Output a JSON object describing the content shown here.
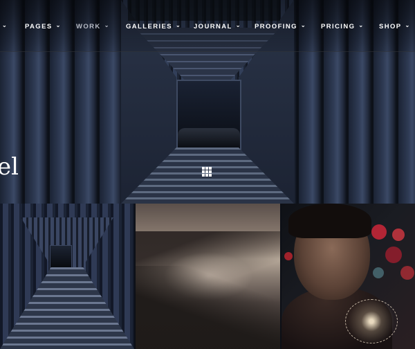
{
  "nav": {
    "items": [
      {
        "label": "",
        "active": false
      },
      {
        "label": "PAGES",
        "active": false
      },
      {
        "label": "WORK",
        "active": true
      },
      {
        "label": "GALLERIES",
        "active": false
      },
      {
        "label": "JOURNAL",
        "active": false
      },
      {
        "label": "PROOFING",
        "active": false
      },
      {
        "label": "PRICING",
        "active": false
      },
      {
        "label": "SHOP",
        "active": false
      }
    ],
    "chevron_icon": "chevron-down-icon"
  },
  "hero": {
    "title_fragment": "el",
    "grid_icon": "grid-icon"
  },
  "gallery": {
    "tiles": [
      {
        "subject": "corridor"
      },
      {
        "subject": "misty-mountains"
      },
      {
        "subject": "portrait-with-lights"
      }
    ]
  },
  "colors": {
    "nav_text": "#ffffff",
    "nav_active": "#b8bcc6",
    "background": "#0c0f16"
  }
}
